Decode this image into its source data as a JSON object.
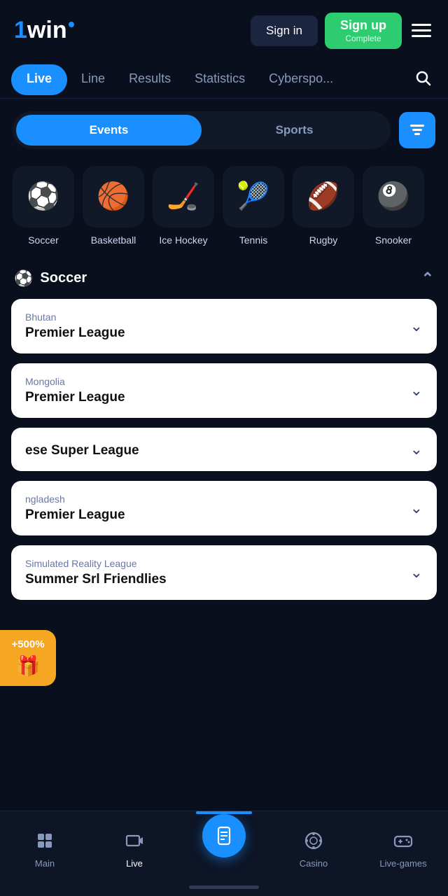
{
  "header": {
    "logo_one": "1",
    "logo_win": "win",
    "signin_label": "Sign in",
    "signup_label": "Sign up",
    "signup_sublabel": "Complete"
  },
  "nav": {
    "tabs": [
      {
        "label": "Live",
        "active": true
      },
      {
        "label": "Line",
        "active": false
      },
      {
        "label": "Results",
        "active": false
      },
      {
        "label": "Statistics",
        "active": false
      },
      {
        "label": "Cyberspo...",
        "active": false
      }
    ]
  },
  "toggle": {
    "events_label": "Events",
    "sports_label": "Sports"
  },
  "sports": [
    {
      "label": "Soccer",
      "icon": "⚽"
    },
    {
      "label": "Basketball",
      "icon": "🏀"
    },
    {
      "label": "Ice Hockey",
      "icon": "🏒"
    },
    {
      "label": "Tennis",
      "icon": "🎾"
    },
    {
      "label": "Rugby",
      "icon": "🏈"
    },
    {
      "label": "Snooker",
      "icon": "🎱"
    }
  ],
  "soccer_section": {
    "title": "Soccer"
  },
  "leagues": [
    {
      "country": "Bhutan",
      "name": "Premier League"
    },
    {
      "country": "Mongolia",
      "name": "Premier League"
    },
    {
      "country": "",
      "name": "ese Super League"
    },
    {
      "country": "ngladesh",
      "name": "Premier League"
    },
    {
      "country": "Simulated Reality League",
      "name": "Summer Srl Friendlies"
    }
  ],
  "promo": {
    "percent": "+500%",
    "icon": "🎁"
  },
  "bottom_nav": [
    {
      "label": "Main",
      "icon": "📱"
    },
    {
      "label": "Live",
      "icon": "📺"
    },
    {
      "label": "",
      "icon": "🎫",
      "center": true
    },
    {
      "label": "Casino",
      "icon": "🎰"
    },
    {
      "label": "Live-games",
      "icon": "🎮"
    }
  ],
  "bottom_nav_active": "Live"
}
